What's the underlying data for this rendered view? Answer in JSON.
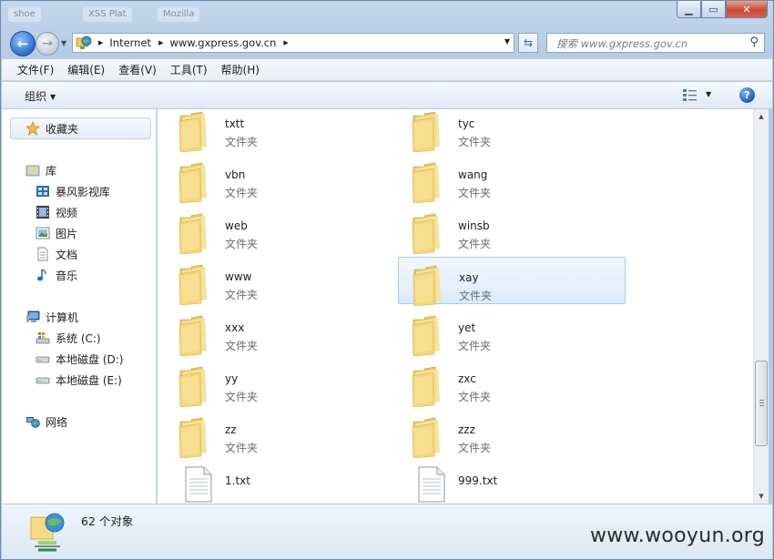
{
  "titlebar": {
    "ghost_tabs": [
      "shoe",
      "XSS Plat",
      "Mozilla"
    ]
  },
  "address_bar": {
    "segments": [
      "Internet",
      "www.gxpress.gov.cn"
    ]
  },
  "search": {
    "placeholder": "搜索 www.gxpress.gov.cn"
  },
  "menu": [
    "文件(F)",
    "编辑(E)",
    "查看(V)",
    "工具(T)",
    "帮助(H)"
  ],
  "toolbar": {
    "organize_label": "组织"
  },
  "nav": {
    "favorites": "收藏夹",
    "libraries": "库",
    "library_items": [
      "暴风影视库",
      "视频",
      "图片",
      "文档",
      "音乐"
    ],
    "computer": "计算机",
    "drives": [
      "系统 (C:)",
      "本地磁盘 (D:)",
      "本地磁盘 (E:)"
    ],
    "network": "网络"
  },
  "files": [
    {
      "name": "txtt",
      "type": "文件夹",
      "kind": "folder"
    },
    {
      "name": "tyc",
      "type": "文件夹",
      "kind": "folder"
    },
    {
      "name": "vbn",
      "type": "文件夹",
      "kind": "folder"
    },
    {
      "name": "wang",
      "type": "文件夹",
      "kind": "folder"
    },
    {
      "name": "web",
      "type": "文件夹",
      "kind": "folder"
    },
    {
      "name": "winsb",
      "type": "文件夹",
      "kind": "folder"
    },
    {
      "name": "www",
      "type": "文件夹",
      "kind": "folder"
    },
    {
      "name": "xay",
      "type": "文件夹",
      "kind": "folder",
      "selected": true
    },
    {
      "name": "xxx",
      "type": "文件夹",
      "kind": "folder"
    },
    {
      "name": "yet",
      "type": "文件夹",
      "kind": "folder"
    },
    {
      "name": "yy",
      "type": "文件夹",
      "kind": "folder"
    },
    {
      "name": "zxc",
      "type": "文件夹",
      "kind": "folder"
    },
    {
      "name": "zz",
      "type": "文件夹",
      "kind": "folder"
    },
    {
      "name": "zzz",
      "type": "文件夹",
      "kind": "folder"
    },
    {
      "name": "1.txt",
      "type": "",
      "kind": "file"
    },
    {
      "name": "999.txt",
      "type": "",
      "kind": "file"
    }
  ],
  "details": {
    "count": "62 个对象"
  },
  "watermark": "www.wooyun.org",
  "colors": {
    "selection_border": "#a9cbf0",
    "folder": "#f4d77a",
    "close_button": "#c94a36"
  }
}
